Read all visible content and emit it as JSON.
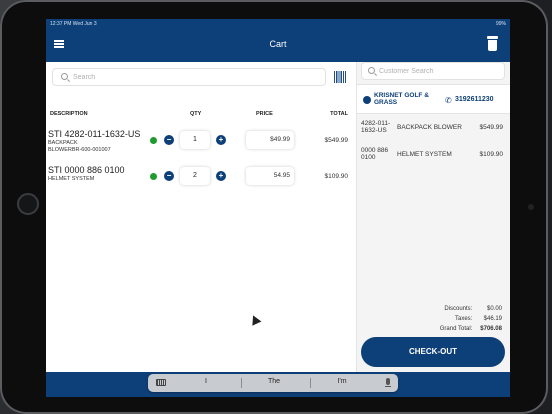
{
  "status": {
    "time": "12:37 PM",
    "date": "Wed Jun 3",
    "battery": "99%"
  },
  "header": {
    "title": "Cart"
  },
  "search": {
    "placeholder": "Search"
  },
  "columns": {
    "description": "DESCRIPTION",
    "qty": "QTY",
    "price": "PRICE",
    "total": "TOTAL"
  },
  "items": [
    {
      "code": "STI 4282-011-1632-US",
      "desc_line1": "BACKPACK",
      "desc_line2": "BLOWERBR-600-001007",
      "qty": "1",
      "price": "$49.99",
      "total": "$549.99"
    },
    {
      "code": "STI 0000 886 0100",
      "desc_line1": "HELMET SYSTEM",
      "desc_line2": "",
      "qty": "2",
      "price": "54.95",
      "total": "$109.90"
    }
  ],
  "customer": {
    "search_placeholder": "Customer Search",
    "name": "KRISNET GOLF & GRASS",
    "phone": "3192611230"
  },
  "summary": [
    {
      "sku": "4282-011-1632-US",
      "desc": "BACKPACK BLOWER",
      "amount": "$549.99"
    },
    {
      "sku": "0000 886 0100",
      "desc": "HELMET SYSTEM",
      "amount": "$109.90"
    }
  ],
  "totals": {
    "discounts_label": "Discounts:",
    "discounts": "$0.00",
    "taxes_label": "Taxes:",
    "taxes": "$46.19",
    "grand_label": "Grand Total:",
    "grand": "$706.08"
  },
  "checkout": {
    "label": "CHECK-OUT"
  },
  "keyboard": {
    "suggestions": [
      "I",
      "The",
      "I'm"
    ]
  },
  "colors": {
    "brand": "#0d3f78",
    "status_green": "#1e9c2e",
    "panel_bg": "#f4f4f5"
  }
}
